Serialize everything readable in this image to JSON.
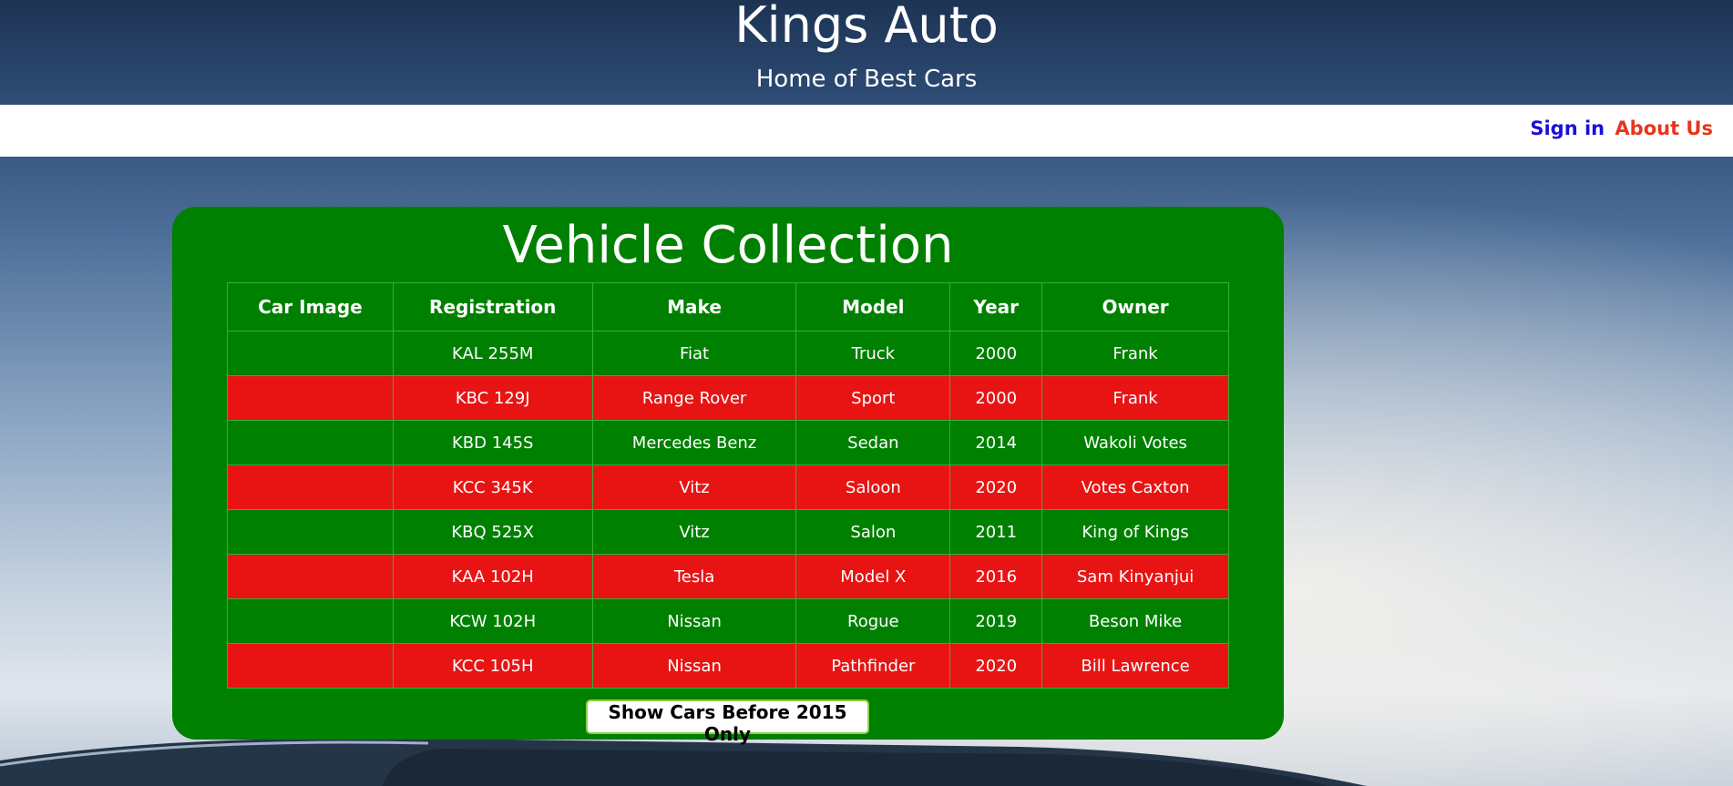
{
  "header": {
    "title": "Kings Auto",
    "subtitle": "Home of Best Cars"
  },
  "nav": {
    "signin_label": "Sign in",
    "about_label": "About Us"
  },
  "collection": {
    "title": "Vehicle Collection",
    "columns": [
      "Car Image",
      "Registration",
      "Make",
      "Model",
      "Year",
      "Owner"
    ],
    "rows": [
      {
        "registration": "KAL 255M",
        "make": "Fiat",
        "model": "Truck",
        "year": "2000",
        "owner": "Frank"
      },
      {
        "registration": "KBC 129J",
        "make": "Range Rover",
        "model": "Sport",
        "year": "2000",
        "owner": "Frank"
      },
      {
        "registration": "KBD 145S",
        "make": "Mercedes Benz",
        "model": "Sedan",
        "year": "2014",
        "owner": "Wakoli Votes"
      },
      {
        "registration": "KCC 345K",
        "make": "Vitz",
        "model": "Saloon",
        "year": "2020",
        "owner": "Votes Caxton"
      },
      {
        "registration": "KBQ 525X",
        "make": "Vitz",
        "model": "Salon",
        "year": "2011",
        "owner": "King of Kings"
      },
      {
        "registration": "KAA 102H",
        "make": "Tesla",
        "model": "Model X",
        "year": "2016",
        "owner": "Sam Kinyanjui"
      },
      {
        "registration": "KCW 102H",
        "make": "Nissan",
        "model": "Rogue",
        "year": "2019",
        "owner": "Beson Mike"
      },
      {
        "registration": "KCC 105H",
        "make": "Nissan",
        "model": "Pathfinder",
        "year": "2020",
        "owner": "Bill Lawrence"
      }
    ],
    "filter_button_label": "Show Cars Before 2015 Only"
  },
  "colors": {
    "panel": "#008000",
    "row_alt": "#e81414",
    "signin": "#1a0fd6",
    "about": "#e8341c"
  }
}
